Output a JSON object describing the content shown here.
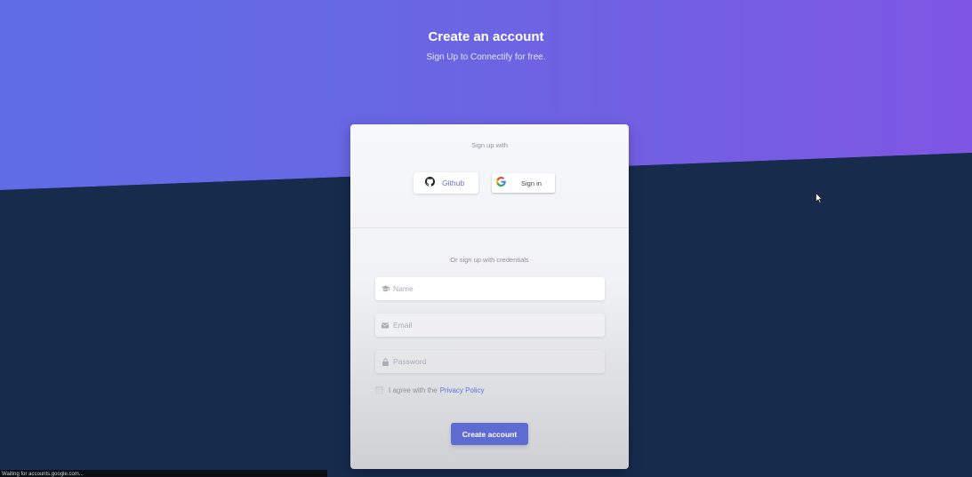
{
  "header": {
    "title": "Create an account",
    "subtitle": "Sign Up to Connectify for free."
  },
  "social": {
    "heading": "Sign up with",
    "github_label": "Github",
    "github_icon": "github-icon",
    "google_label": "Sign in",
    "google_icon": "google-icon"
  },
  "form": {
    "heading": "Or sign up with credentials",
    "name_placeholder": "Name",
    "name_icon": "graduation-cap-icon",
    "email_placeholder": "Email",
    "email_icon": "envelope-icon",
    "password_placeholder": "Password",
    "password_icon": "lock-icon",
    "agree_text": "I agree with the",
    "privacy_link": "Privacy Policy",
    "submit_label": "Create account"
  },
  "status": {
    "text": "Waiting for accounts.google.com..."
  },
  "colors": {
    "gradient_start": "#5f6ce6",
    "gradient_end": "#7e56e3",
    "background": "#172b4d",
    "primary": "#5e72e4",
    "button": "#5e6bd0"
  }
}
